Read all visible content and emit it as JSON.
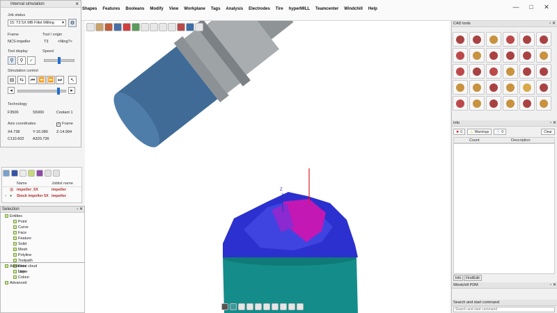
{
  "menu": [
    "Shapes",
    "Features",
    "Booleans",
    "Modify",
    "View",
    "Workplane",
    "Tags",
    "Analysis",
    "Electrodes",
    "Tire",
    "hyperMILL",
    "Teamcenter",
    "Windchill",
    "Help"
  ],
  "window_buttons": [
    "—",
    "□",
    "✕"
  ],
  "sim": {
    "title": "Internal simulation",
    "job_status_label": "Job status",
    "job_status_value": "15: T3 5X MB Fillet Milling",
    "frame_label": "Frame",
    "tool_origin_label": "Tool / origin",
    "frame_value": "NCS impeller",
    "tool_value": "T3",
    "origin_value": "<Ning?>",
    "tool_display_label": "Tool display",
    "speed_label": "Speed",
    "sim_control_label": "Simulation control",
    "technology_label": "Technology",
    "feed": "F3500",
    "spindle": "S5000",
    "coolant": "Coolant  1",
    "axis_coords_label": "Axis coordinates",
    "frame_check_label": "Frame",
    "x": "X4.738",
    "y": "Y-16.080",
    "z": "Z-14.994",
    "c": "C110.602",
    "a": "A320.736",
    "speed_level": 0.5,
    "progress": 0.86
  },
  "joblist": {
    "col_name": "Name",
    "col_joblist": "Joblist name",
    "rows": [
      {
        "name": "impeller_5X",
        "joblist": "impeller"
      },
      {
        "name": "Stock impeller 5X",
        "joblist": "impeller"
      }
    ]
  },
  "selection": {
    "title": "Selection",
    "items": [
      "Entities",
      "Point",
      "Curve",
      "Face",
      "Feature",
      "Solid",
      "Mesh",
      "Polyline",
      "Toolpath",
      "Point cloud",
      "Note"
    ],
    "attributes": [
      "Attributes",
      "Layer",
      "Colour",
      "Advanced"
    ]
  },
  "cad": {
    "title": "CAD tools"
  },
  "info": {
    "title": "Info",
    "errors_count": "0",
    "warnings_label": "Warnings",
    "messages_count": "0",
    "clear_label": "Clear",
    "col_count": "Count",
    "col_description": "Description",
    "tabs": [
      "Info",
      "Find/Edit"
    ]
  },
  "pdm": {
    "title": "Windchill PDM"
  },
  "search": {
    "title": "Search and start command",
    "placeholder": "Search and start command"
  },
  "colors": {
    "spindle_body": "#9ea3a6",
    "tool_head": "#3f6b96",
    "workpiece_teal": "#148c8a",
    "impeller_blue": "#2b30cf",
    "impeller_magenta": "#c318b4",
    "axis_red": "#e11d1d"
  }
}
